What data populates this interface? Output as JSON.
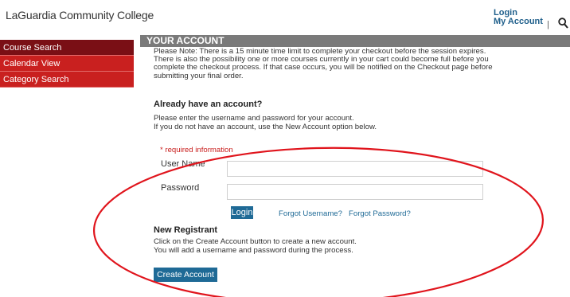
{
  "header": {
    "site_title": "LaGuardia Community College",
    "login_link": "Login",
    "account_link": "My Account",
    "separator": "|",
    "search_icon": "search-icon"
  },
  "sidebar": {
    "items": [
      {
        "label": "Course Search",
        "active": true
      },
      {
        "label": "Calendar View",
        "active": false
      },
      {
        "label": "Category Search",
        "active": false
      }
    ]
  },
  "main": {
    "section_title": "YOUR ACCOUNT",
    "note_lines": [
      "Please Note: There is a 15 minute time limit to complete your checkout before the session expires.",
      "There is also the possibility one or more courses currently in your cart could become full before you",
      "complete the checkout process. If that case occurs, you will be notified on the Checkout page before",
      "submitting your final order."
    ],
    "account_heading": "Already have an account?",
    "account_instructions": [
      "Please enter the username and password for your account.",
      "If you do not have an account, use the New Account option below."
    ],
    "required_text": "* required information",
    "username_label": "User Name",
    "username_value": "",
    "password_label": "Password",
    "password_value": "",
    "login_button": "Login",
    "forgot_username": "Forgot Username?",
    "forgot_password": "Forgot Password?",
    "new_heading": "New Registrant",
    "new_instructions": [
      "Click on the Create Account button to create a new account.",
      "You will add a username and password during the process."
    ],
    "create_button": "Create Account"
  },
  "colors": {
    "sidebar_red": "#c9201f",
    "sidebar_active": "#7a0f15",
    "section_bar": "#7a7a7a",
    "button_blue": "#1f6a96",
    "annotation_ellipse": "#e0141c"
  }
}
